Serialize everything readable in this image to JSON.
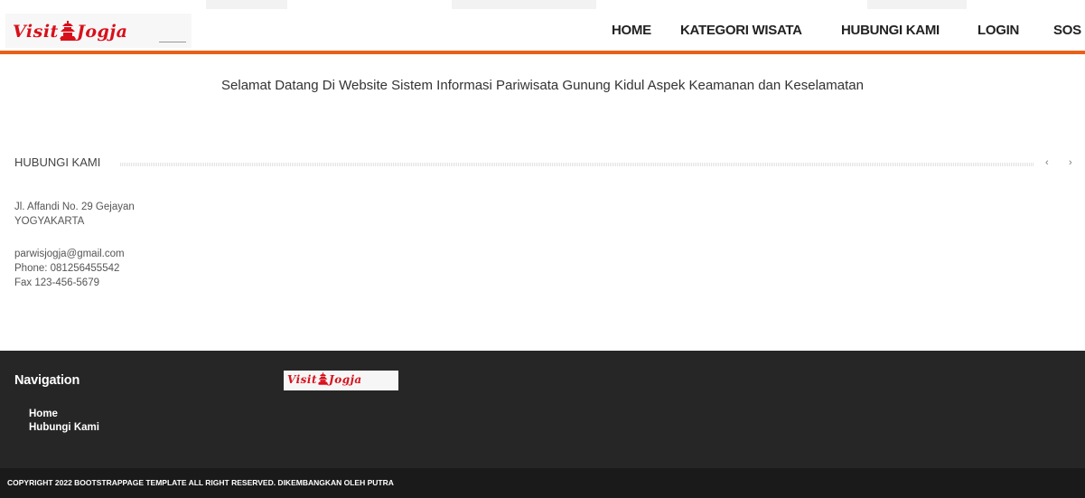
{
  "brand": {
    "logo_text_left": "Visit",
    "logo_text_right": "Jogja",
    "accent_color": "#e8611a",
    "logo_color": "#d8101b"
  },
  "nav": {
    "items": [
      {
        "label": "HOME"
      },
      {
        "label": "KATEGORI WISATA"
      },
      {
        "label": "HUBUNGI KAMI"
      },
      {
        "label": "LOGIN"
      },
      {
        "label": "SOS"
      }
    ]
  },
  "welcome": "Selamat Datang Di Website Sistem Informasi Pariwisata Gunung Kidul Aspek Keamanan dan Keselamatan",
  "section": {
    "title": "HUBUNGI KAMI",
    "prev": "‹",
    "next": "›"
  },
  "contact": {
    "address_line1": "Jl. Affandi No. 29 Gejayan",
    "address_line2": "YOGYAKARTA",
    "email": "parwisjogja@gmail.com",
    "phone": "Phone: 081256455542",
    "fax": "Fax 123-456-5679"
  },
  "footer": {
    "heading": "Navigation",
    "links": [
      {
        "label": "Home"
      },
      {
        "label": "Hubungi Kami"
      }
    ],
    "copyright": "COPYRIGHT 2022 BOOTSTRAPPAGE TEMPLATE ALL RIGHT RESERVED. DIKEMBANGKAN OLEH PUTRA"
  }
}
